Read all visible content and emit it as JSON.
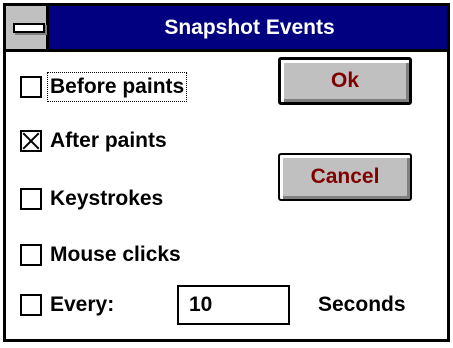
{
  "window": {
    "title": "Snapshot Events",
    "system_menu_icon": "system-menu-icon"
  },
  "options": [
    {
      "label": "Before paints",
      "checked": false,
      "focused": true
    },
    {
      "label": "After paints",
      "checked": true,
      "focused": false
    },
    {
      "label": "Keystrokes",
      "checked": false,
      "focused": false
    },
    {
      "label": "Mouse clicks",
      "checked": false,
      "focused": false
    },
    {
      "label": "Every:",
      "checked": false,
      "focused": false
    }
  ],
  "interval": {
    "value": "10",
    "unit_label": "Seconds"
  },
  "buttons": {
    "ok_label": "Ok",
    "cancel_label": "Cancel"
  },
  "colors": {
    "title_bar": "#000080",
    "button_text": "#800000",
    "button_face": "#c0c0c0"
  }
}
